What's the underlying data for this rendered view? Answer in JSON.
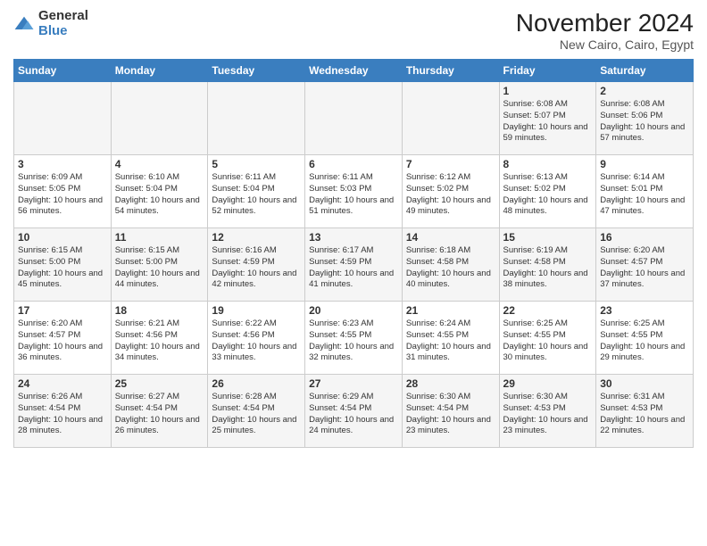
{
  "logo": {
    "general": "General",
    "blue": "Blue"
  },
  "title": "November 2024",
  "location": "New Cairo, Cairo, Egypt",
  "days_of_week": [
    "Sunday",
    "Monday",
    "Tuesday",
    "Wednesday",
    "Thursday",
    "Friday",
    "Saturday"
  ],
  "weeks": [
    [
      {
        "day": "",
        "info": ""
      },
      {
        "day": "",
        "info": ""
      },
      {
        "day": "",
        "info": ""
      },
      {
        "day": "",
        "info": ""
      },
      {
        "day": "",
        "info": ""
      },
      {
        "day": "1",
        "info": "Sunrise: 6:08 AM\nSunset: 5:07 PM\nDaylight: 10 hours and 59 minutes."
      },
      {
        "day": "2",
        "info": "Sunrise: 6:08 AM\nSunset: 5:06 PM\nDaylight: 10 hours and 57 minutes."
      }
    ],
    [
      {
        "day": "3",
        "info": "Sunrise: 6:09 AM\nSunset: 5:05 PM\nDaylight: 10 hours and 56 minutes."
      },
      {
        "day": "4",
        "info": "Sunrise: 6:10 AM\nSunset: 5:04 PM\nDaylight: 10 hours and 54 minutes."
      },
      {
        "day": "5",
        "info": "Sunrise: 6:11 AM\nSunset: 5:04 PM\nDaylight: 10 hours and 52 minutes."
      },
      {
        "day": "6",
        "info": "Sunrise: 6:11 AM\nSunset: 5:03 PM\nDaylight: 10 hours and 51 minutes."
      },
      {
        "day": "7",
        "info": "Sunrise: 6:12 AM\nSunset: 5:02 PM\nDaylight: 10 hours and 49 minutes."
      },
      {
        "day": "8",
        "info": "Sunrise: 6:13 AM\nSunset: 5:02 PM\nDaylight: 10 hours and 48 minutes."
      },
      {
        "day": "9",
        "info": "Sunrise: 6:14 AM\nSunset: 5:01 PM\nDaylight: 10 hours and 47 minutes."
      }
    ],
    [
      {
        "day": "10",
        "info": "Sunrise: 6:15 AM\nSunset: 5:00 PM\nDaylight: 10 hours and 45 minutes."
      },
      {
        "day": "11",
        "info": "Sunrise: 6:15 AM\nSunset: 5:00 PM\nDaylight: 10 hours and 44 minutes."
      },
      {
        "day": "12",
        "info": "Sunrise: 6:16 AM\nSunset: 4:59 PM\nDaylight: 10 hours and 42 minutes."
      },
      {
        "day": "13",
        "info": "Sunrise: 6:17 AM\nSunset: 4:59 PM\nDaylight: 10 hours and 41 minutes."
      },
      {
        "day": "14",
        "info": "Sunrise: 6:18 AM\nSunset: 4:58 PM\nDaylight: 10 hours and 40 minutes."
      },
      {
        "day": "15",
        "info": "Sunrise: 6:19 AM\nSunset: 4:58 PM\nDaylight: 10 hours and 38 minutes."
      },
      {
        "day": "16",
        "info": "Sunrise: 6:20 AM\nSunset: 4:57 PM\nDaylight: 10 hours and 37 minutes."
      }
    ],
    [
      {
        "day": "17",
        "info": "Sunrise: 6:20 AM\nSunset: 4:57 PM\nDaylight: 10 hours and 36 minutes."
      },
      {
        "day": "18",
        "info": "Sunrise: 6:21 AM\nSunset: 4:56 PM\nDaylight: 10 hours and 34 minutes."
      },
      {
        "day": "19",
        "info": "Sunrise: 6:22 AM\nSunset: 4:56 PM\nDaylight: 10 hours and 33 minutes."
      },
      {
        "day": "20",
        "info": "Sunrise: 6:23 AM\nSunset: 4:55 PM\nDaylight: 10 hours and 32 minutes."
      },
      {
        "day": "21",
        "info": "Sunrise: 6:24 AM\nSunset: 4:55 PM\nDaylight: 10 hours and 31 minutes."
      },
      {
        "day": "22",
        "info": "Sunrise: 6:25 AM\nSunset: 4:55 PM\nDaylight: 10 hours and 30 minutes."
      },
      {
        "day": "23",
        "info": "Sunrise: 6:25 AM\nSunset: 4:55 PM\nDaylight: 10 hours and 29 minutes."
      }
    ],
    [
      {
        "day": "24",
        "info": "Sunrise: 6:26 AM\nSunset: 4:54 PM\nDaylight: 10 hours and 28 minutes."
      },
      {
        "day": "25",
        "info": "Sunrise: 6:27 AM\nSunset: 4:54 PM\nDaylight: 10 hours and 26 minutes."
      },
      {
        "day": "26",
        "info": "Sunrise: 6:28 AM\nSunset: 4:54 PM\nDaylight: 10 hours and 25 minutes."
      },
      {
        "day": "27",
        "info": "Sunrise: 6:29 AM\nSunset: 4:54 PM\nDaylight: 10 hours and 24 minutes."
      },
      {
        "day": "28",
        "info": "Sunrise: 6:30 AM\nSunset: 4:54 PM\nDaylight: 10 hours and 23 minutes."
      },
      {
        "day": "29",
        "info": "Sunrise: 6:30 AM\nSunset: 4:53 PM\nDaylight: 10 hours and 23 minutes."
      },
      {
        "day": "30",
        "info": "Sunrise: 6:31 AM\nSunset: 4:53 PM\nDaylight: 10 hours and 22 minutes."
      }
    ]
  ]
}
